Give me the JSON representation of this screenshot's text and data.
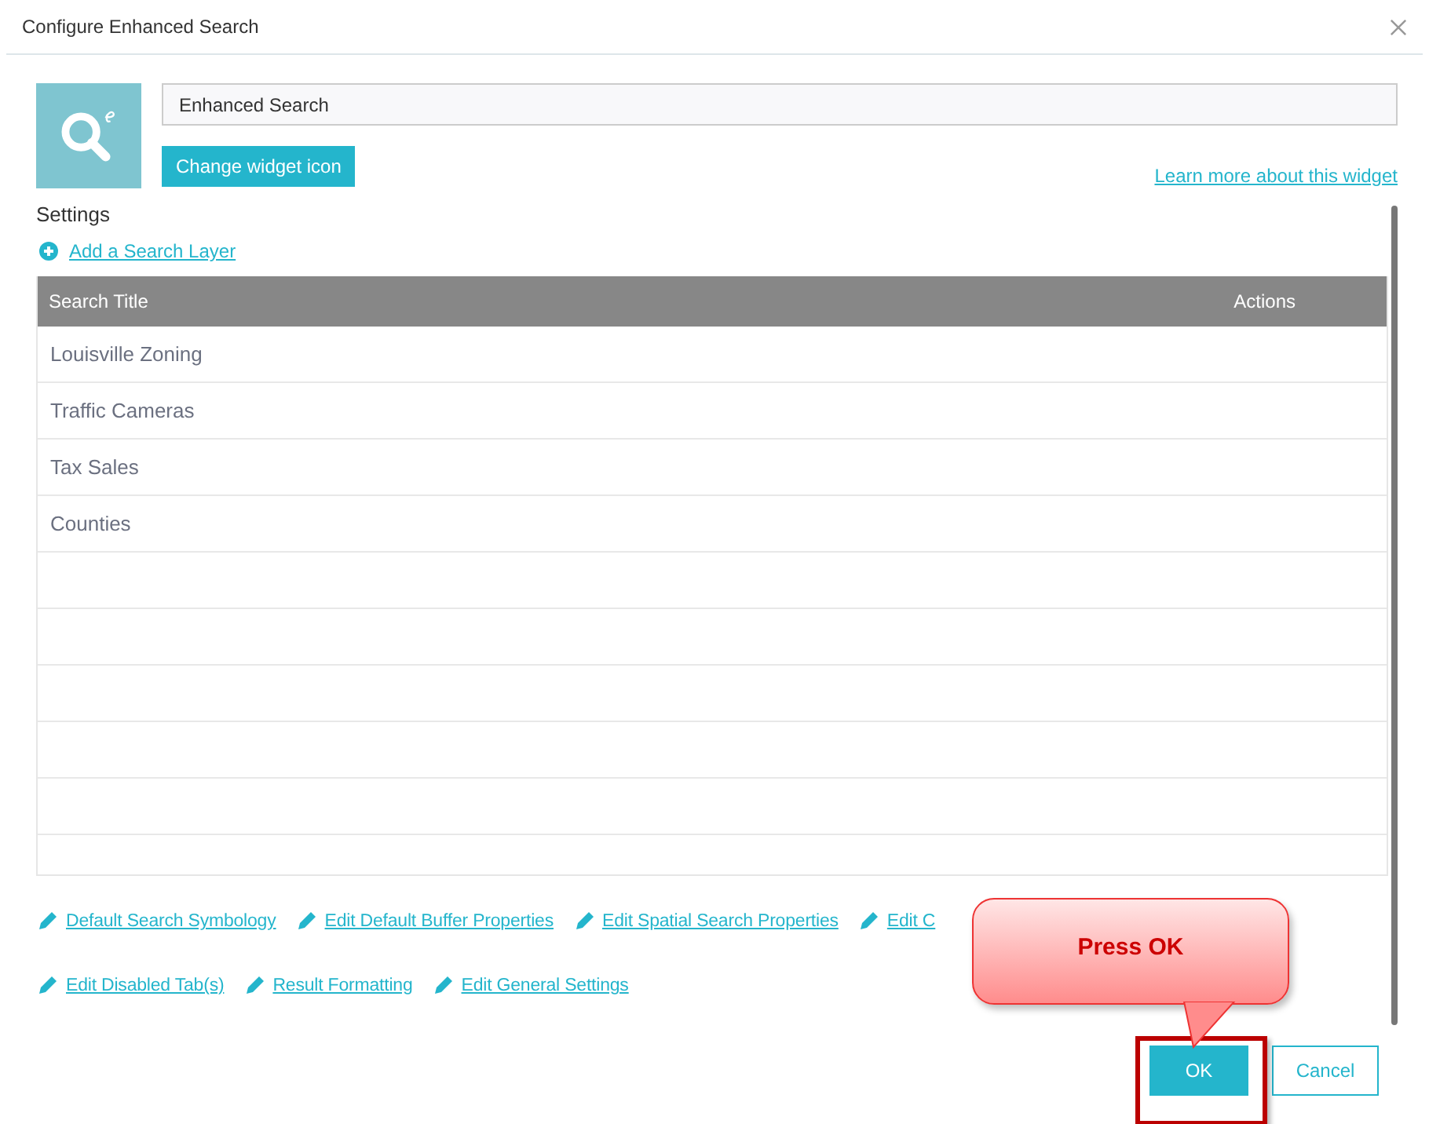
{
  "window": {
    "title": "Configure Enhanced Search"
  },
  "widget": {
    "name_value": "Enhanced Search",
    "change_icon_button": "Change widget icon",
    "learn_more_link": "Learn more about this widget"
  },
  "settings": {
    "label": "Settings",
    "add_layer_link": "Add a Search Layer"
  },
  "table": {
    "columns": [
      "Search Title",
      "Actions"
    ],
    "rows": [
      "Louisville Zoning",
      "Traffic Cameras",
      "Tax Sales",
      "Counties"
    ]
  },
  "action_links": [
    [
      "Default Search Symbology",
      "Edit Default Buffer Properties",
      "Edit Spatial Search Properties",
      "Edit C"
    ],
    [
      "Edit Disabled Tab(s)",
      "Result Formatting",
      "Edit General Settings"
    ]
  ],
  "callout": {
    "text": "Press OK"
  },
  "buttons": [
    {
      "label": "OK",
      "kind": "primary"
    },
    {
      "label": "Cancel",
      "kind": "secondary"
    }
  ]
}
